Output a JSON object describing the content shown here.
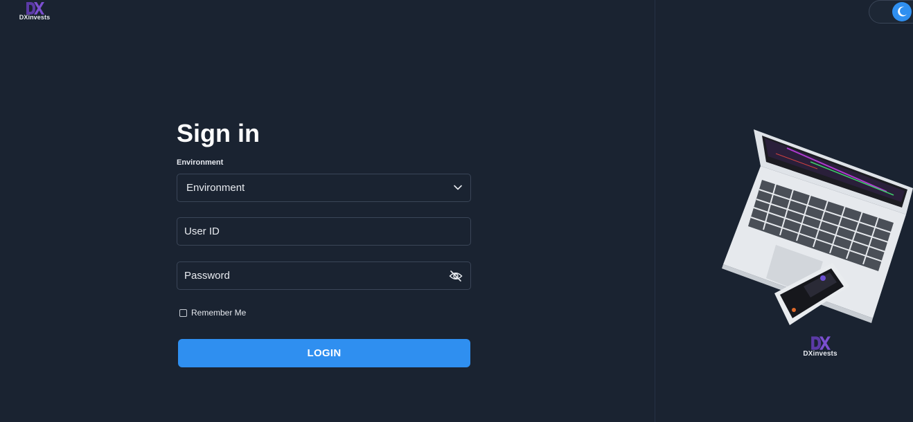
{
  "brand": {
    "name": "DXinvests",
    "mark_color": "#6a3fb5"
  },
  "theme_toggle": {
    "icon": "moon-icon",
    "accent": "#2f8ff0"
  },
  "form": {
    "title": "Sign in",
    "environment_label": "Environment",
    "environment_selected": "Environment",
    "user_id_placeholder": "User ID",
    "password_placeholder": "Password",
    "remember_label": "Remember Me",
    "remember_checked": false,
    "login_label": "LOGIN"
  },
  "colors": {
    "background": "#1a2331",
    "primary": "#2f8ff0",
    "field_border": "#3b4658"
  },
  "illustration": {
    "icon": "laptop-phone-illustration"
  }
}
